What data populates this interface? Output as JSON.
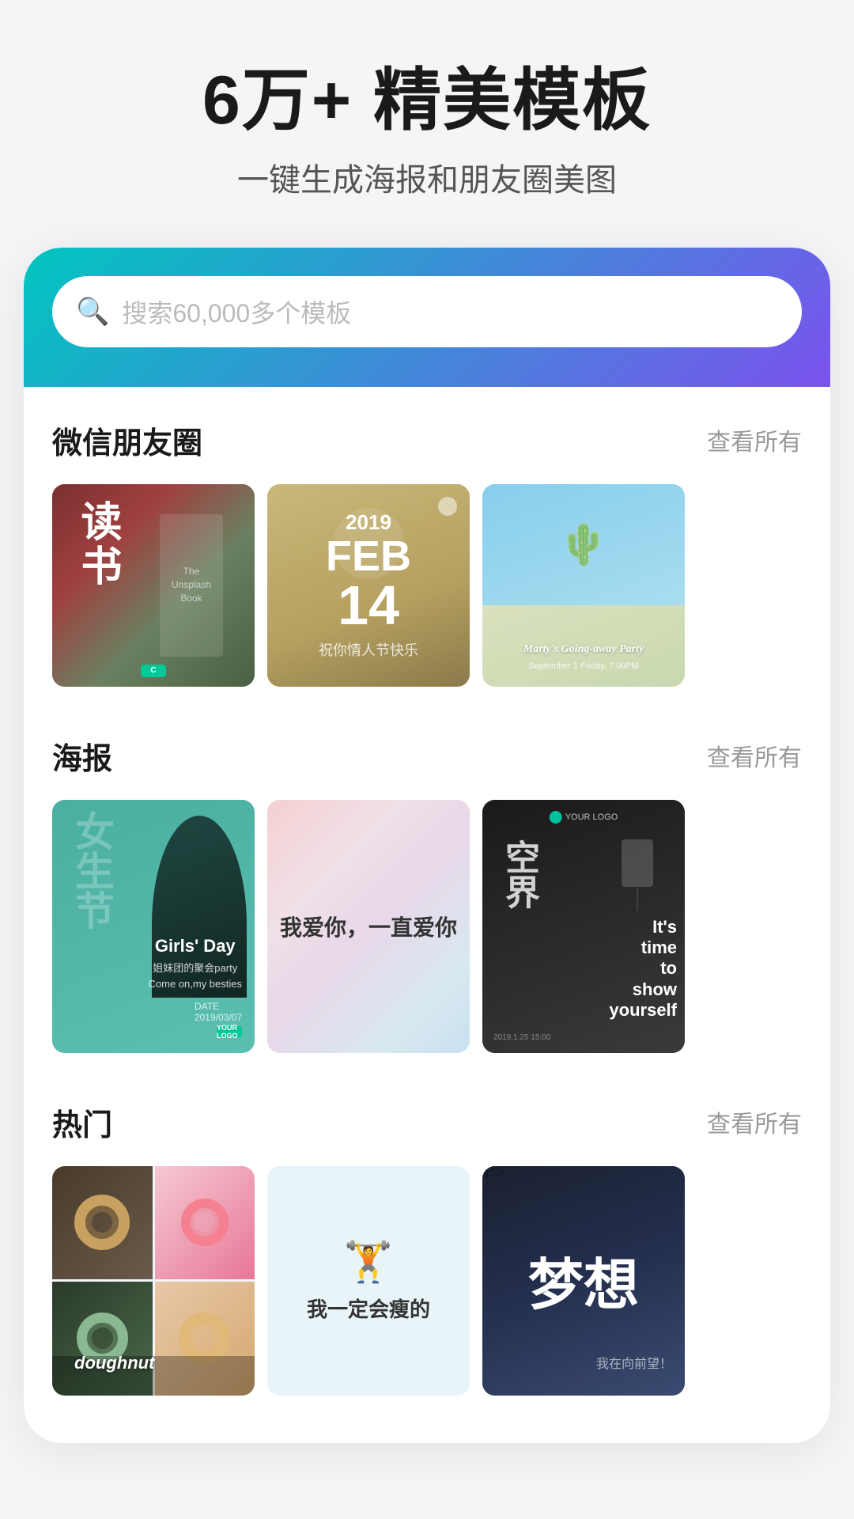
{
  "hero": {
    "title": "6万+ 精美模板",
    "subtitle": "一键生成海报和朋友圈美图"
  },
  "search": {
    "placeholder": "搜索60,000多个模板",
    "icon": "🔍"
  },
  "sections": [
    {
      "id": "wechat",
      "title": "微信朋友圈",
      "link_label": "查看所有",
      "templates": [
        {
          "id": "reading",
          "label": "读书"
        },
        {
          "id": "valentine",
          "label": "2019 FEB 14"
        },
        {
          "id": "party",
          "label": "Marty's Going-away Party"
        }
      ]
    },
    {
      "id": "poster",
      "title": "海报",
      "link_label": "查看所有",
      "templates": [
        {
          "id": "girlsday",
          "label": "Girls' Day"
        },
        {
          "id": "love",
          "label": "我爱你，一直爱你"
        },
        {
          "id": "show",
          "label": "It's time to show yourself"
        }
      ]
    },
    {
      "id": "hot",
      "title": "热门",
      "link_label": "查看所有",
      "templates": [
        {
          "id": "doughnut",
          "label": "doughnut"
        },
        {
          "id": "motivation",
          "label": "我一定会瘦的"
        },
        {
          "id": "dream",
          "label": "梦想"
        }
      ]
    }
  ],
  "cards": {
    "reading_vertical": "读书",
    "reading_side": "The Unsplash Book",
    "valentine_year": "2019",
    "valentine_month": "FEB",
    "valentine_day": "14",
    "valentine_sub": "祝你情人节快乐",
    "party_title": "Marty's Going-away Party",
    "party_details": "September 1 Friday, 7:00PM",
    "girlsday_cn": "女生节",
    "girlsday_title": "Girls' Day",
    "girlsday_sub1": "姐妹团的聚会party",
    "girlsday_sub2": "Come on,my besties",
    "girlsday_date": "DATE 2019/03/07",
    "love_text": "我爱你，一直爱你",
    "show_cn": "空界",
    "show_logo": "YOUR LOGO",
    "show_en1": "It's",
    "show_en2": "time",
    "show_en3": "to",
    "show_en4": "show",
    "show_en5": "yourself",
    "doughnut_label": "doughnut",
    "motivation_text": "我一定会瘦的",
    "dream_text": "梦想",
    "dream_sub": "我在向前望！"
  }
}
